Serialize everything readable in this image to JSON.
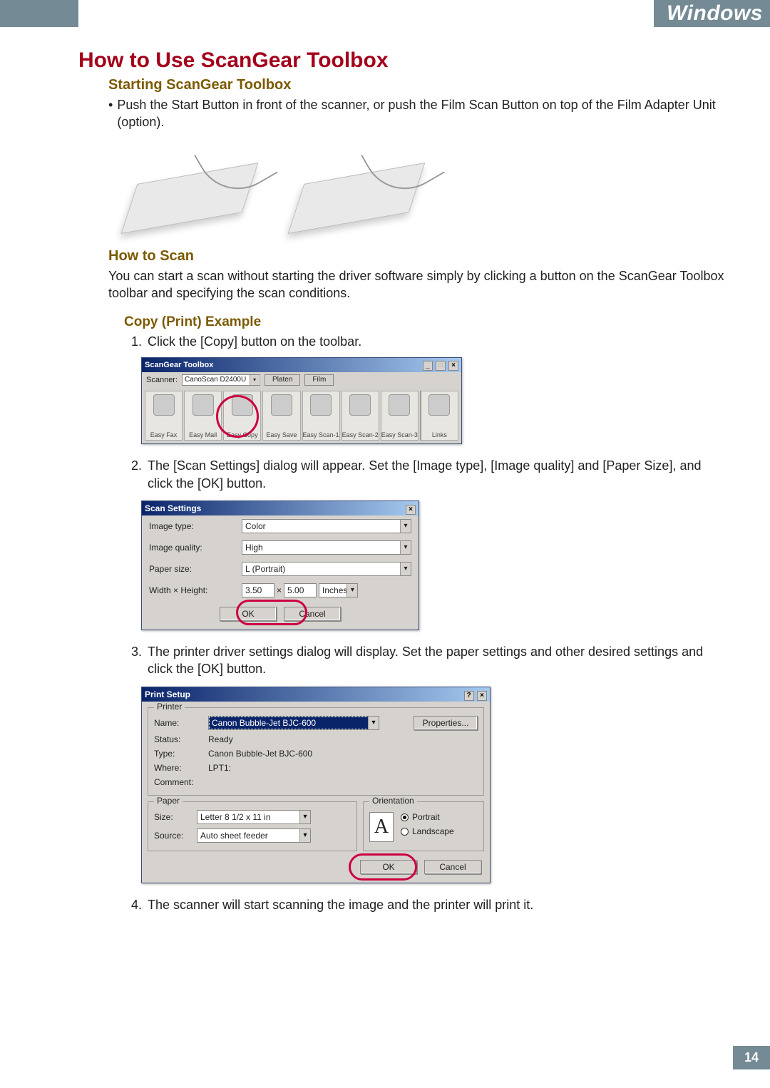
{
  "header": {
    "os_label": "Windows"
  },
  "section_title": "How to Use ScanGear Toolbox",
  "starting": {
    "heading": "Starting ScanGear Toolbox",
    "bullet": "Push the Start Button in front of the scanner, or push the Film Scan Button on top of the Film Adapter Unit (option)."
  },
  "how_to_scan": {
    "heading": "How to Scan",
    "text": "You can start a scan without starting the driver software simply by clicking a button on the ScanGear Toolbox toolbar and specifying the scan conditions."
  },
  "copy_example": {
    "heading": "Copy (Print) Example",
    "step1": "Click the [Copy] button on the toolbar.",
    "step2": "The [Scan Settings] dialog will appear. Set the [Image type], [Image quality] and [Paper Size], and click the [OK] button.",
    "step3": "The printer driver settings dialog will display. Set the paper settings and other desired settings and click the [OK] button.",
    "step4": "The scanner will start scanning the image and the printer will print it."
  },
  "toolbox": {
    "title": "ScanGear Toolbox",
    "scanner_label": "Scanner:",
    "scanner_value": "CanoScan D2400U",
    "platen_btn": "Platen",
    "film_btn": "Film",
    "buttons": [
      {
        "label": "Easy Fax"
      },
      {
        "label": "Easy Mail"
      },
      {
        "label": "Easy Copy"
      },
      {
        "label": "Easy Save"
      },
      {
        "label": "Easy Scan-1"
      },
      {
        "label": "Easy Scan-2"
      },
      {
        "label": "Easy Scan-3"
      },
      {
        "label": "Links"
      }
    ]
  },
  "scan_settings": {
    "title": "Scan Settings",
    "image_type_label": "Image type:",
    "image_type_value": "Color",
    "image_quality_label": "Image quality:",
    "image_quality_value": "High",
    "paper_size_label": "Paper size:",
    "paper_size_value": "L (Portrait)",
    "wh_label": "Width × Height:",
    "width_value": "3.50",
    "times": "×",
    "height_value": "5.00",
    "unit_value": "Inches",
    "ok": "OK",
    "cancel": "Cancel"
  },
  "print_setup": {
    "title": "Print Setup",
    "printer_group": "Printer",
    "name_label": "Name:",
    "name_value": "Canon Bubble-Jet BJC-600",
    "properties": "Properties...",
    "status_label": "Status:",
    "status_value": "Ready",
    "type_label": "Type:",
    "type_value": "Canon Bubble-Jet BJC-600",
    "where_label": "Where:",
    "where_value": "LPT1:",
    "comment_label": "Comment:",
    "paper_group": "Paper",
    "size_label": "Size:",
    "size_value": "Letter 8 1/2 x 11 in",
    "source_label": "Source:",
    "source_value": "Auto sheet feeder",
    "orient_group": "Orientation",
    "portrait": "Portrait",
    "landscape": "Landscape",
    "ok": "OK",
    "cancel": "Cancel"
  },
  "page_number": "14"
}
